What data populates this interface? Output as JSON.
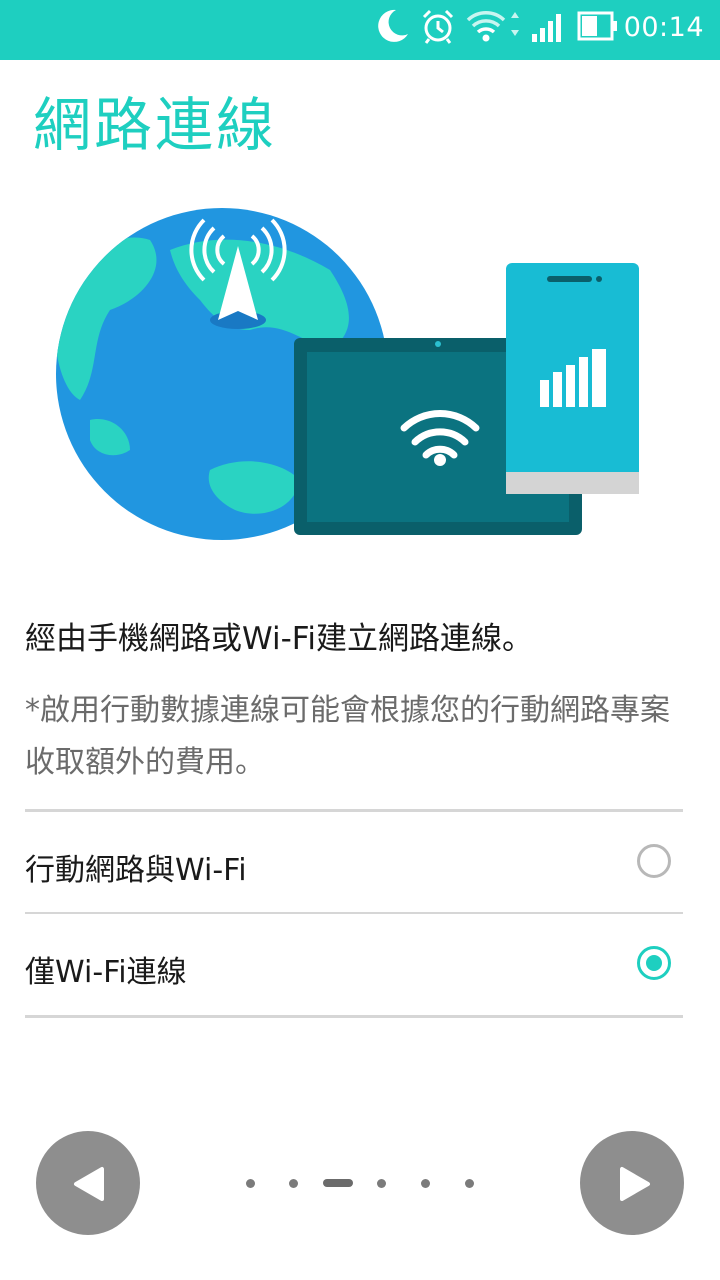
{
  "status_bar": {
    "time": "00:14",
    "icons": [
      "moon-icon",
      "alarm-icon",
      "wifi-icon",
      "signal-icon",
      "battery-icon"
    ],
    "color": "#1ecfc0"
  },
  "page": {
    "title": "網路連線",
    "description": "經由手機網路或Wi-Fi建立網路連線。",
    "note": "*啟用行動數據連線可能會根據您的行動網路專案收取額外的費用。"
  },
  "options": [
    {
      "label": "行動網路與Wi-Fi",
      "selected": false
    },
    {
      "label": "僅Wi-Fi連線",
      "selected": true
    }
  ],
  "navigation": {
    "back_icon": "triangle-left-icon",
    "next_icon": "triangle-right-icon",
    "page_count": 6,
    "current_page": 3
  },
  "colors": {
    "accent": "#1ecfc0",
    "globe_ocean": "#2196e0",
    "globe_land": "#2ad3c2",
    "tablet": "#0a5f6a",
    "phone": "#18bcd4"
  }
}
